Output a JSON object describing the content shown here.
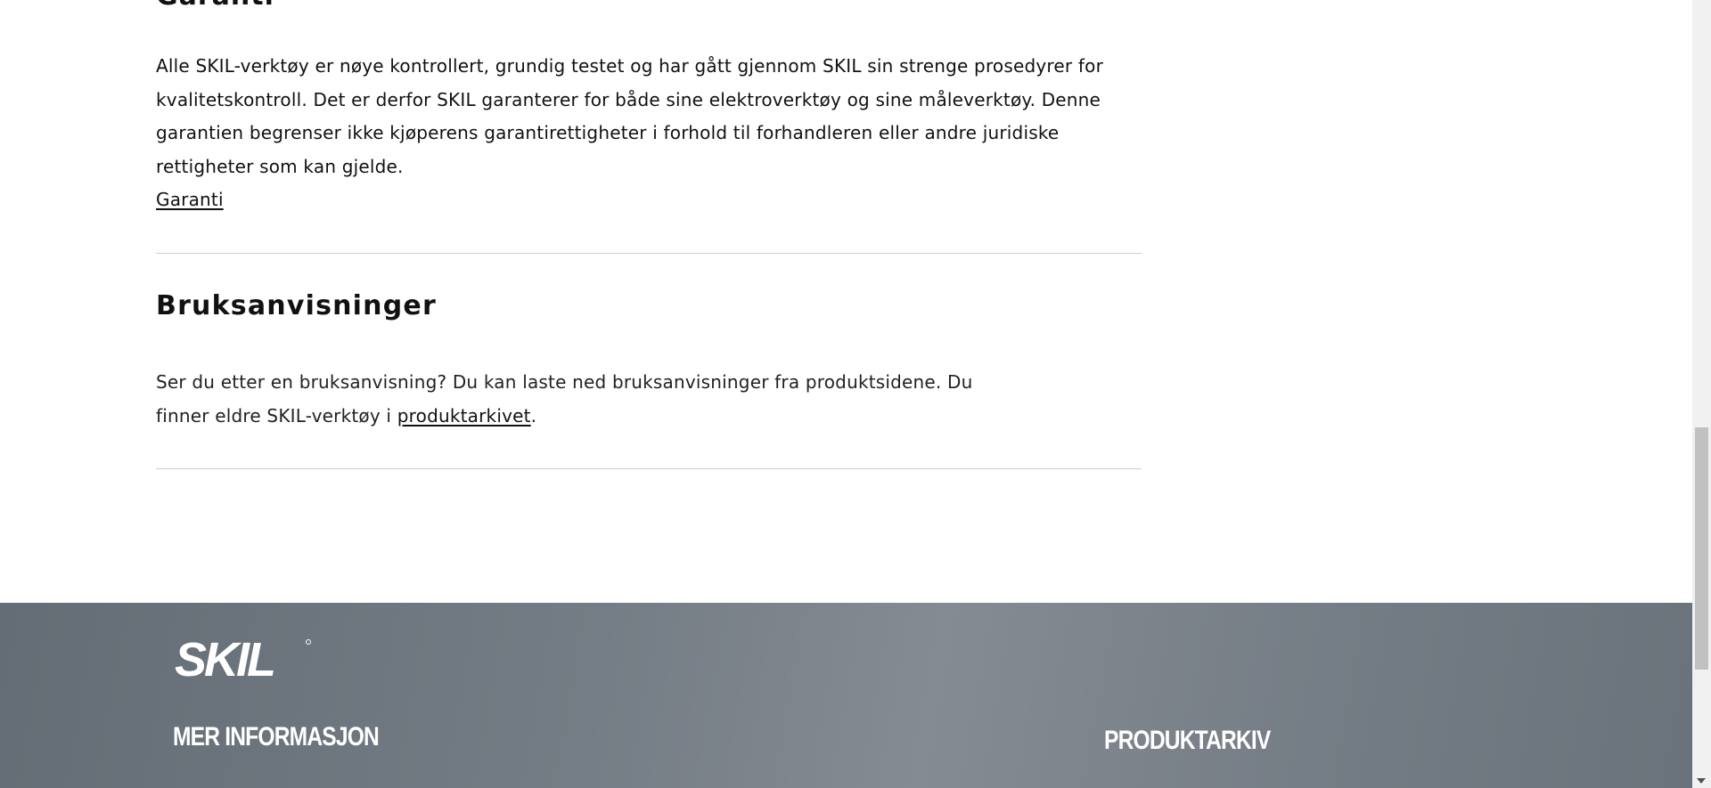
{
  "warranty": {
    "title": "Garanti",
    "body": "Alle SKIL-verktøy er nøye kontrollert, grundig testet og har gått gjennom SKIL sin strenge prosedyrer for kvalitetskontroll. Det er derfor SKIL garanterer for både sine elektroverktøy og sine måleverktøy. Denne garantien begrenser ikke kjøperens garantirettigheter i forhold til forhandleren eller andre juridiske rettigheter som kan gjelde.",
    "link_label": "Garanti"
  },
  "manuals": {
    "title": "Bruksanvisninger",
    "body_start": "Ser du etter en bruksanvisning? Du kan laste ned bruksanvisninger fra produktsidene. Du finner eldre SKIL-verktøy i ",
    "link_label": "produktarkivet",
    "body_end": "."
  },
  "footer": {
    "logo_text": "SKIL",
    "more_info_heading": "MER INFORMASJON",
    "product_archive_heading": "PRODUKTARKIV"
  },
  "colors": {
    "footer_bg": "#747c85",
    "divider": "#cfcfcf",
    "text": "#111111"
  }
}
